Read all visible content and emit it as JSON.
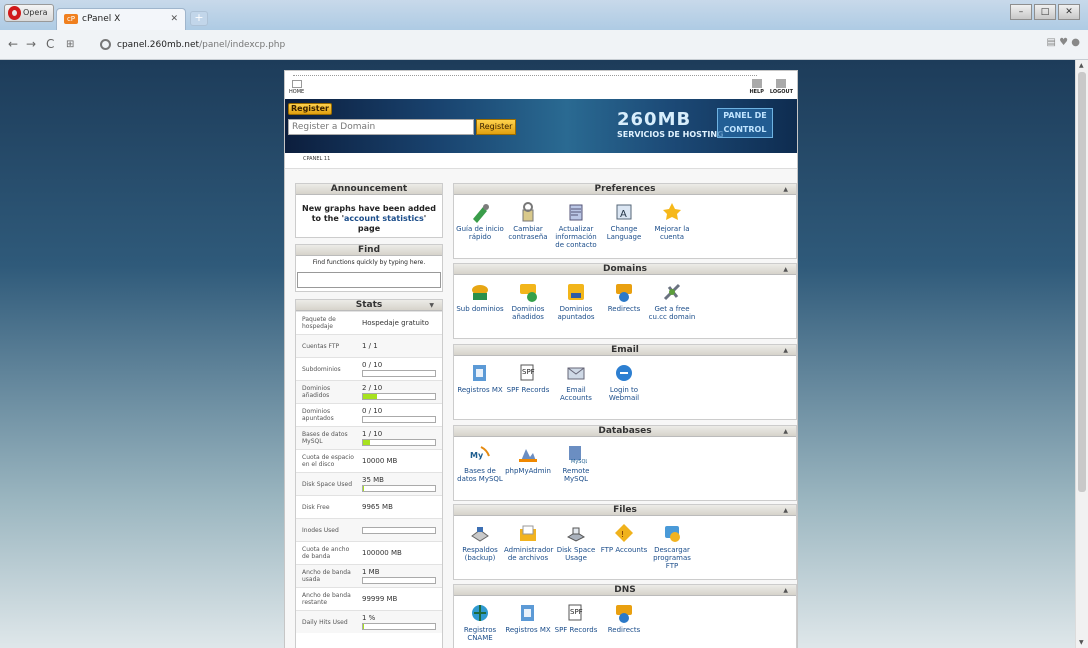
{
  "browser": {
    "opera_label": "Opera",
    "tab_title": "cPanel X",
    "new_tab": "+",
    "url_host": "cpanel.260mb.net",
    "url_path": "/panel/indexcp.php"
  },
  "top": {
    "home": "HOME",
    "help": "HELP",
    "logout": "LOGOUT"
  },
  "banner": {
    "register_tag": "Register",
    "domain_placeholder": "Register a Domain",
    "register_button": "Register",
    "brand": "260MB",
    "brand_sub": "SERVICIOS DE HOSTING",
    "panel_line1": "PANEL DE",
    "panel_line2": "CONTROL"
  },
  "cpanel_version": "CPANEL 11",
  "announcement": {
    "title": "Announcement",
    "text_pre": "New graphs have been added to the '",
    "link": "account statistics",
    "text_post": "' page"
  },
  "find": {
    "title": "Find",
    "description": "Find functions quickly by typing here."
  },
  "stats": {
    "title": "Stats",
    "rows": [
      {
        "label": "Paquete de hospedaje",
        "value": "Hospedaje gratuito"
      },
      {
        "label": "Cuentas FTP",
        "value": "1 / 1"
      },
      {
        "label": "Subdominios",
        "value": "0 / 10",
        "usage": 0
      },
      {
        "label": "Dominios añadidos",
        "value": "2 / 10",
        "usage": 20
      },
      {
        "label": "Dominios apuntados",
        "value": "0 / 10",
        "usage": 0
      },
      {
        "label": "Bases de datos MySQL",
        "value": "1 / 10",
        "usage": 10
      },
      {
        "label": "Cuota de espacio en el disco",
        "value": "10000 MB"
      },
      {
        "label": "Disk Space Used",
        "value": "35 MB",
        "usage": 0.35
      },
      {
        "label": "Disk Free",
        "value": "9965 MB"
      },
      {
        "label": "Inodes Used",
        "value": "",
        "usage": 0
      },
      {
        "label": "Cuota de ancho de banda",
        "value": "100000 MB"
      },
      {
        "label": "Ancho de banda usada",
        "value": "1 MB",
        "usage": 0.001
      },
      {
        "label": "Ancho de banda restante",
        "value": "99999 MB"
      },
      {
        "label": "Daily Hits Used",
        "value": "1 %",
        "usage": 1
      }
    ]
  },
  "sections": [
    {
      "title": "Preferences",
      "items": [
        "Guía de inicio rápido",
        "Cambiar contraseña",
        "Actualizar información de contacto",
        "Change Language",
        "Mejorar la cuenta"
      ]
    },
    {
      "title": "Domains",
      "items": [
        "Sub dominios",
        "Dominios añadidos",
        "Dominios apuntados",
        "Redirects",
        "Get a free cu.cc domain"
      ]
    },
    {
      "title": "Email",
      "items": [
        "Registros MX",
        "SPF Records",
        "Email Accounts",
        "Login to Webmail"
      ]
    },
    {
      "title": "Databases",
      "items": [
        "Bases de datos MySQL",
        "phpMyAdmin",
        "Remote MySQL"
      ]
    },
    {
      "title": "Files",
      "items": [
        "Respaldos (backup)",
        "Administrador de archivos",
        "Disk Space Usage",
        "FTP Accounts",
        "Descargar programas FTP"
      ]
    },
    {
      "title": "DNS",
      "items": [
        "Registros CNAME",
        "Registros MX",
        "SPF Records",
        "Redirects"
      ]
    }
  ],
  "colors": {
    "usage_bar": "#a7e21e",
    "link": "#1b4d8a",
    "header_bg": "#d6d3cb"
  }
}
